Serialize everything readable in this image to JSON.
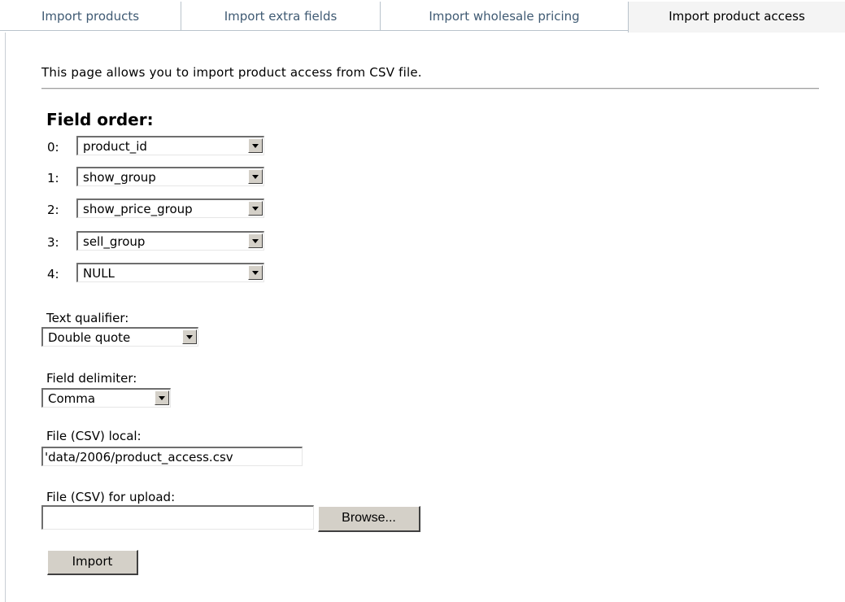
{
  "tabs": [
    {
      "label": "Import products",
      "active": false
    },
    {
      "label": "Import extra fields",
      "active": false
    },
    {
      "label": "Import wholesale pricing",
      "active": false
    },
    {
      "label": "Import product access",
      "active": true
    }
  ],
  "intro_text": "This page allows you to import product access from CSV file.",
  "field_order": {
    "title": "Field order:",
    "rows": [
      {
        "index": "0:",
        "value": "product_id"
      },
      {
        "index": "1:",
        "value": "show_group"
      },
      {
        "index": "2:",
        "value": "show_price_group"
      },
      {
        "index": "3:",
        "value": "sell_group"
      },
      {
        "index": "4:",
        "value": "NULL"
      }
    ]
  },
  "text_qualifier": {
    "label": "Text qualifier:",
    "value": "Double quote"
  },
  "field_delimiter": {
    "label": "Field delimiter:",
    "value": "Comma"
  },
  "file_local": {
    "label": "File (CSV) local:",
    "value": "'data/2006/product_access.csv"
  },
  "file_upload": {
    "label": "File (CSV) for upload:",
    "value": "",
    "browse_label": "Browse..."
  },
  "import_button_label": "Import",
  "colors": {
    "tab_text": "#3f5a73",
    "tab_border": "#b9c3cc",
    "button_face": "#d4d0c8"
  },
  "icons": {
    "dropdown_arrow": "chevron-down-icon"
  }
}
